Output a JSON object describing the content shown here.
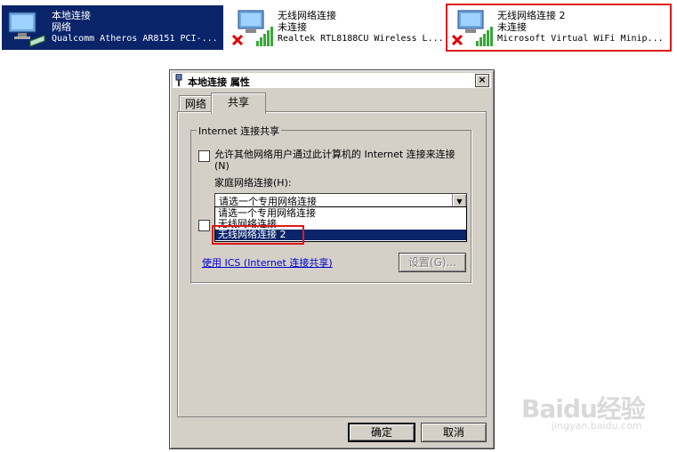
{
  "connections": [
    {
      "name": "本地连接",
      "status": "网络",
      "device": "Qualcomm Atheros AR8151 PCI-...",
      "icon": "lan-adapter-icon"
    },
    {
      "name": "无线网络连接",
      "status": "未连接",
      "device": "Realtek RTL8188CU Wireless L...",
      "icon": "wifi-adapter-disconnected-icon"
    },
    {
      "name": "无线网络连接 2",
      "status": "未连接",
      "device": "Microsoft Virtual WiFi Minip...",
      "icon": "wifi-adapter-disconnected-icon"
    }
  ],
  "dialog": {
    "title": "本地连接 属性",
    "close_label": "×",
    "tabs": [
      {
        "label": "网络"
      },
      {
        "label": "共享"
      }
    ],
    "group_title": "Internet 连接共享",
    "allow_sharing_label": "允许其他网络用户通过此计算机的 Internet 连接来连接(N)",
    "home_network_label": "家庭网络连接(H):",
    "combo_value": "请选一个专用网络连接",
    "dropdown_options": [
      "请选一个专用网络连接",
      "无线网络连接",
      "无线网络连接 2"
    ],
    "selected_option": "无线网络连接 2",
    "ics_link": "使用 ICS (Internet 连接共享)",
    "settings_button": "设置(G)...",
    "ok_button": "确定",
    "cancel_button": "取消"
  },
  "watermark": {
    "brand": "Baidu经验",
    "url": "jingyan.baidu.com"
  },
  "colors": {
    "selection": "#0a246a",
    "highlight_outline": "#e0181b",
    "dialog_face": "#d4d0c8"
  }
}
